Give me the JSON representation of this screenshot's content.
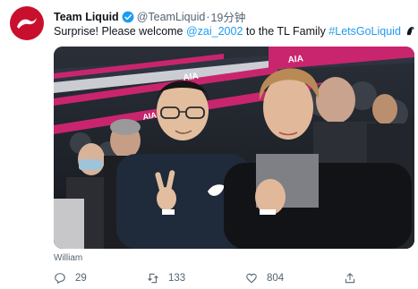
{
  "tweet": {
    "author_name": "Team Liquid",
    "author_handle": "@TeamLiquid",
    "separator": "·",
    "time": "19分钟",
    "text_before": "Surprise! Please welcome ",
    "mention": "@zai_2002",
    "text_middle": " to the TL Family ",
    "hashtag": "#LetsGoLiquid",
    "media_caption": "William",
    "banner_text": "AIA"
  },
  "actions": {
    "reply_count": "29",
    "retweet_count": "133",
    "like_count": "804"
  },
  "colors": {
    "brand": "#c8102e",
    "link": "#1d9bf0",
    "muted": "#536471"
  }
}
